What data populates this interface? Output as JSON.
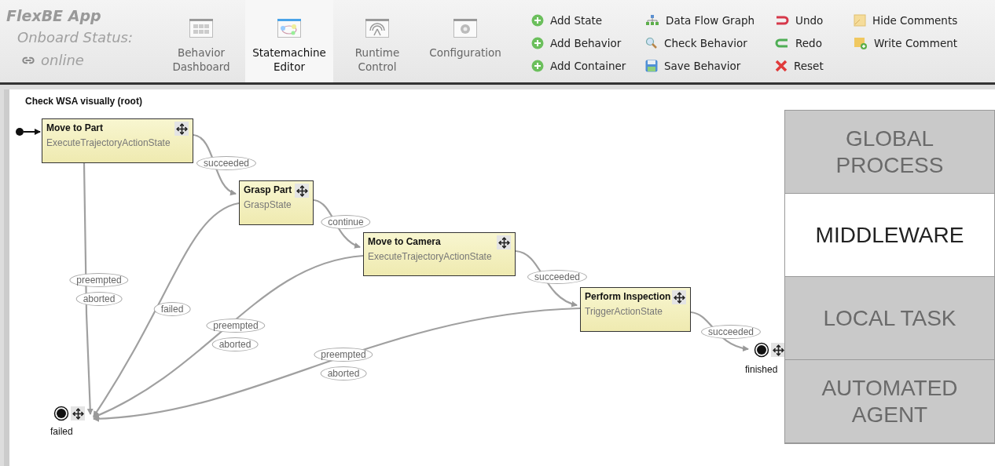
{
  "app": {
    "title": "FlexBE App",
    "status_label": "Onboard Status:",
    "status_value": "online"
  },
  "tabs": [
    {
      "label": "Behavior Dashboard",
      "selected": false
    },
    {
      "label": "Statemachine Editor",
      "selected": true
    },
    {
      "label": "Runtime Control",
      "selected": false
    },
    {
      "label": "Configuration",
      "selected": false
    }
  ],
  "actions": [
    [
      "Add State",
      "Add Behavior",
      "Add Container"
    ],
    [
      "Data Flow Graph",
      "Check Behavior",
      "Save Behavior"
    ],
    [
      "Undo",
      "Redo",
      "Reset"
    ],
    [
      "Hide Comments",
      "Write Comment"
    ]
  ],
  "canvas": {
    "title": "Check WSA visually (root)",
    "states": [
      {
        "name": "Move to Part",
        "class": "ExecuteTrajectoryActionState"
      },
      {
        "name": "Grasp Part",
        "class": "GraspState"
      },
      {
        "name": "Move to Camera",
        "class": "ExecuteTrajectoryActionState"
      },
      {
        "name": "Perform Inspection",
        "class": "TriggerActionState"
      }
    ],
    "outcomes": [
      {
        "label": "finished"
      },
      {
        "label": "failed"
      }
    ],
    "transitions": [
      {
        "outcomes": [
          "succeeded"
        ]
      },
      {
        "outcomes": [
          "continue"
        ]
      },
      {
        "outcomes": [
          "succeeded"
        ]
      },
      {
        "outcomes": [
          "succeeded"
        ]
      },
      {
        "outcomes": [
          "preempted",
          "aborted"
        ]
      },
      {
        "outcomes": [
          "failed"
        ]
      },
      {
        "outcomes": [
          "preempted",
          "aborted"
        ]
      },
      {
        "outcomes": [
          "preempted",
          "aborted"
        ]
      }
    ]
  },
  "layers": [
    {
      "label": "GLOBAL PROCESS",
      "selected": false
    },
    {
      "label": "MIDDLEWARE",
      "selected": true
    },
    {
      "label": "LOCAL TASK",
      "selected": false
    },
    {
      "label": "AUTOMATED AGENT",
      "selected": false
    }
  ]
}
